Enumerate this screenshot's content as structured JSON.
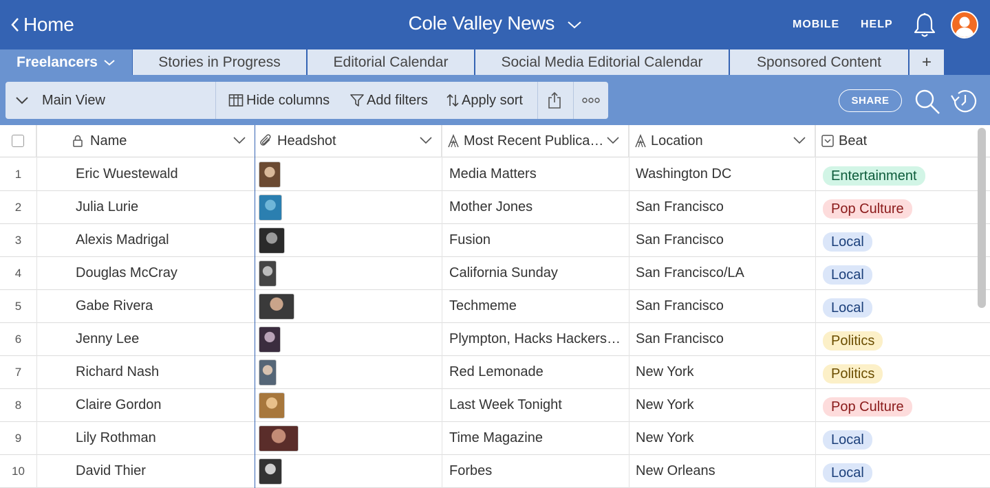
{
  "header": {
    "back_label": "Home",
    "base_name": "Cole Valley News",
    "mobile_label": "MOBILE",
    "help_label": "HELP",
    "bell_icon": "bell-icon",
    "avatar_icon": "user-avatar"
  },
  "tabs": [
    {
      "label": "Freelancers",
      "active": true
    },
    {
      "label": "Stories in Progress"
    },
    {
      "label": "Editorial Calendar"
    },
    {
      "label": "Social Media Editorial Calendar"
    },
    {
      "label": "Sponsored Content"
    },
    {
      "label": "+"
    }
  ],
  "viewbar": {
    "view_name": "Main View",
    "hide_columns": "Hide columns",
    "add_filters": "Add filters",
    "apply_sort": "Apply sort",
    "share": "SHARE"
  },
  "columns": {
    "name": "Name",
    "headshot": "Headshot",
    "publication": "Most Recent Publica…",
    "location": "Location",
    "beat": "Beat"
  },
  "beat_colors": {
    "Entertainment": {
      "bg": "#d2f5e6",
      "fg": "#0d5c3b"
    },
    "Pop Culture": {
      "bg": "#fddcdc",
      "fg": "#8a1a1a"
    },
    "Local": {
      "bg": "#dbe6f9",
      "fg": "#1b3f7a"
    },
    "Politics": {
      "bg": "#fcf0c8",
      "fg": "#6b4d00"
    }
  },
  "rows": [
    {
      "num": "1",
      "name": "Eric Wuestewald",
      "publication": "Media Matters",
      "location": "Washington DC",
      "beat": "Entertainment"
    },
    {
      "num": "2",
      "name": "Julia Lurie",
      "publication": "Mother Jones",
      "location": "San Francisco",
      "beat": "Pop Culture"
    },
    {
      "num": "3",
      "name": "Alexis Madrigal",
      "publication": "Fusion",
      "location": "San Francisco",
      "beat": "Local"
    },
    {
      "num": "4",
      "name": "Douglas McCray",
      "publication": "California Sunday",
      "location": "San Francisco/LA",
      "beat": "Local"
    },
    {
      "num": "5",
      "name": "Gabe Rivera",
      "publication": "Techmeme",
      "location": "San Francisco",
      "beat": "Local"
    },
    {
      "num": "6",
      "name": "Jenny Lee",
      "publication": "Plympton, Hacks Hackers…",
      "location": "San Francisco",
      "beat": "Politics"
    },
    {
      "num": "7",
      "name": "Richard Nash",
      "publication": "Red Lemonade",
      "location": "New York",
      "beat": "Politics"
    },
    {
      "num": "8",
      "name": "Claire Gordon",
      "publication": "Last Week Tonight",
      "location": "New York",
      "beat": "Pop Culture"
    },
    {
      "num": "9",
      "name": "Lily Rothman",
      "publication": "Time Magazine",
      "location": "New York",
      "beat": "Local"
    },
    {
      "num": "10",
      "name": "David Thier",
      "publication": "Forbes",
      "location": "New Orleans",
      "beat": "Local"
    }
  ]
}
